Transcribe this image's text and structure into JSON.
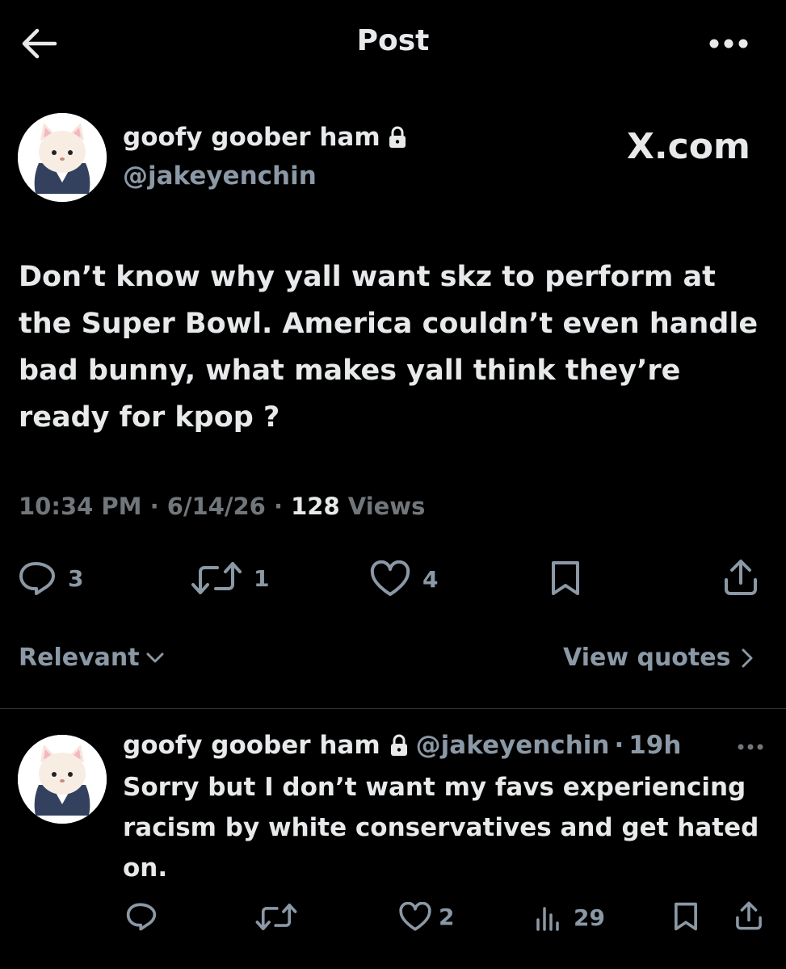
{
  "header": {
    "title": "Post"
  },
  "post": {
    "author_name": "goofy goober ham",
    "author_handle": "@jakeyenchin",
    "brand": "X.com",
    "text": "Don’t know why yall want skz to perform at the Super Bowl. America couldn’t even handle bad bunny, what makes yall think they’re ready for kpop ?",
    "time": "10:34 PM",
    "date": "6/14/26",
    "views_count": "128",
    "views_label": "Views",
    "separator": "·",
    "replies": "3",
    "reposts": "1",
    "likes": "4"
  },
  "sort": {
    "label": "Relevant"
  },
  "quotes": {
    "label": "View quotes"
  },
  "reply": {
    "author_name": "goofy goober ham",
    "author_handle": "@jakeyenchin",
    "time": "19h",
    "separator": "·",
    "text": "Sorry but I don’t want my favs experiencing racism by white conservatives and get hated on.",
    "likes": "2",
    "views": "29"
  },
  "icons": {
    "back": "arrow-left-icon",
    "more": "more-horizontal-icon",
    "lock": "lock-icon",
    "reply": "reply-icon",
    "repost": "repost-icon",
    "like": "heart-icon",
    "bookmark": "bookmark-icon",
    "share": "share-icon",
    "views": "views-icon"
  },
  "colors": {
    "background": "#000000",
    "text": "#e7e9ea",
    "muted": "#71767b",
    "divider": "#2f3336"
  }
}
